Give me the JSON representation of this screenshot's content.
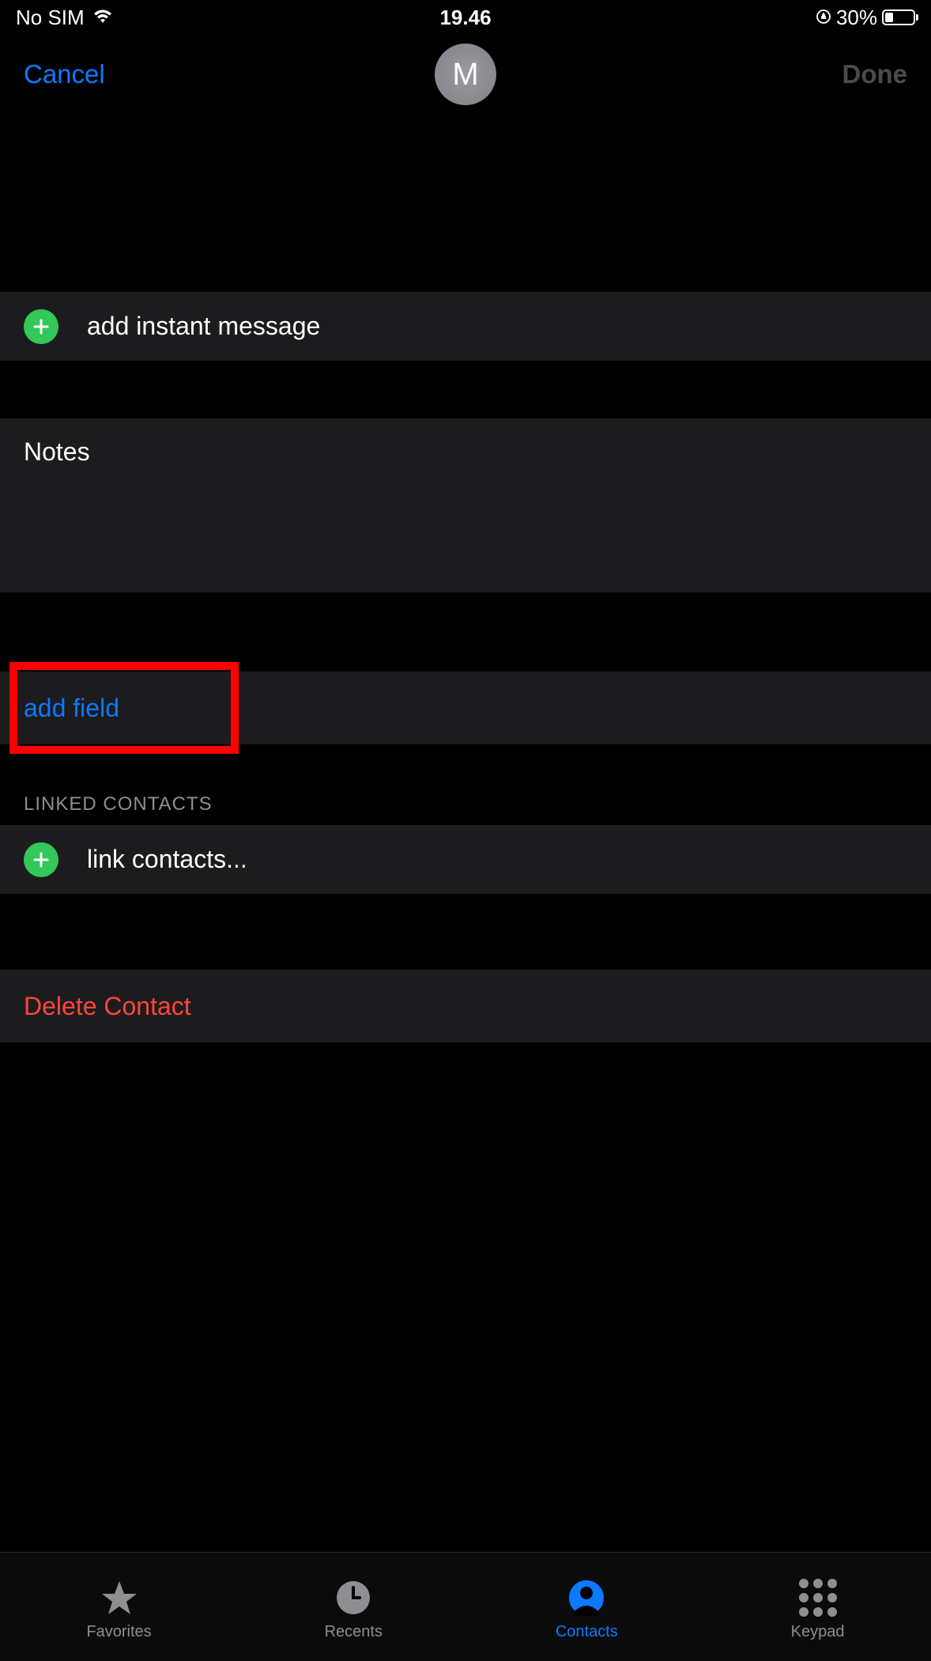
{
  "status": {
    "sim": "No SIM",
    "time": "19.46",
    "battery_pct": "30%",
    "battery_fill_pct": 30
  },
  "nav": {
    "cancel": "Cancel",
    "done": "Done",
    "avatar_initial": "M"
  },
  "rows": {
    "add_instant_message": "add instant message",
    "notes_label": "Notes",
    "add_field": "add field",
    "linked_header": "LINKED CONTACTS",
    "link_contacts": "link contacts...",
    "delete_contact": "Delete Contact"
  },
  "tabs": {
    "favorites": "Favorites",
    "recents": "Recents",
    "contacts": "Contacts",
    "keypad": "Keypad",
    "active": "contacts"
  },
  "colors": {
    "accent": "#0a7aff",
    "destructive": "#ff453a",
    "add_green": "#34c759",
    "cell_bg": "#1c1c1e",
    "highlight": "#ff0000"
  },
  "highlight": {
    "target": "add-field-row"
  }
}
